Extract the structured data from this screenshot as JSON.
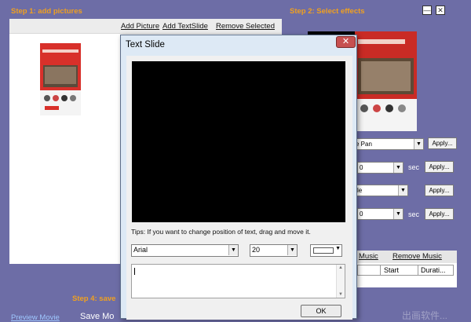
{
  "steps": {
    "step1": "Step 1: add pictures",
    "step2": "Step 2: Select effects",
    "step4": "Step 4: save"
  },
  "window_controls": {
    "minimize": "—",
    "close": "✕"
  },
  "left_panel": {
    "add_picture": "Add Picture",
    "add_textslide": "Add TextSlide",
    "remove_selected": "Remove Selected"
  },
  "bottom": {
    "preview_movie": "Preview Movie",
    "save_movie": "Save Mo"
  },
  "effects": {
    "transition": {
      "value": "e Pan",
      "apply": "Apply..."
    },
    "duration1": {
      "value": "0",
      "unit": "sec",
      "apply": "Apply..."
    },
    "effect2": {
      "value": "le",
      "apply": "Apply..."
    },
    "duration2": {
      "value": "0",
      "unit": "sec",
      "apply": "Apply..."
    }
  },
  "music": {
    "add_music": "Music",
    "remove_music": "Remove Music",
    "columns": [
      "Start",
      "Durati..."
    ]
  },
  "dialog": {
    "title": "Text Slide",
    "close": "✕",
    "tips": "Tips: If you want to change position of text, drag and move it.",
    "font": "Arial",
    "size": "20",
    "ok": "OK",
    "text_value": ""
  },
  "watermark": "出画软件..."
}
